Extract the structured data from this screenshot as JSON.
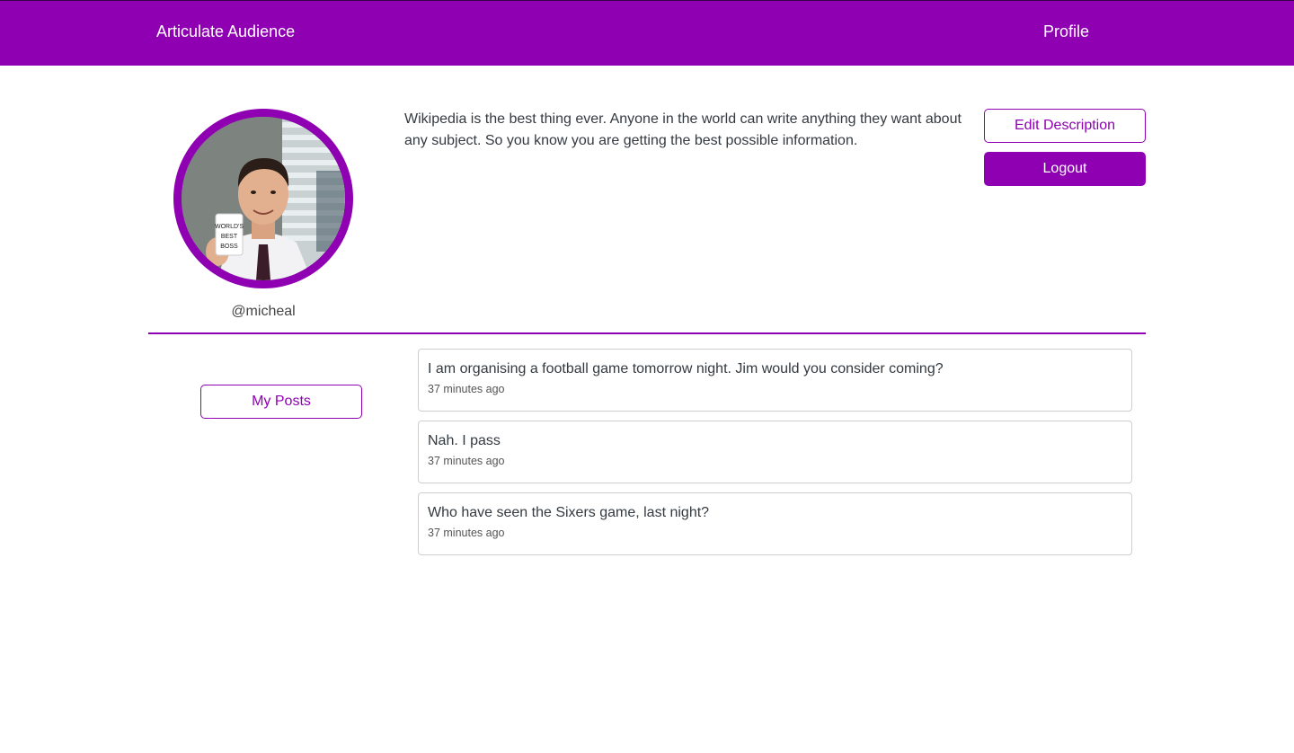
{
  "nav": {
    "brand": "Articulate Audience",
    "profile": "Profile"
  },
  "profile": {
    "username": "@micheal",
    "description": "Wikipedia is the best thing ever. Anyone in the world can write anything they want about any subject. So you know you are getting the best possible information.",
    "edit_label": "Edit Description",
    "logout_label": "Logout",
    "avatar_mug_text": "WORLD'S BEST BOSS"
  },
  "sidebar": {
    "my_posts_label": "My Posts"
  },
  "posts": [
    {
      "text": "I am organising a football game tomorrow night. Jim would you consider coming?",
      "time": "37 minutes ago"
    },
    {
      "text": "Nah. I pass",
      "time": "37 minutes ago"
    },
    {
      "text": "Who have seen the Sixers game, last night?",
      "time": "37 minutes ago"
    }
  ],
  "colors": {
    "accent": "#8f00b3",
    "nav_text": "#ffffff",
    "card_border": "#cfcfcf"
  }
}
